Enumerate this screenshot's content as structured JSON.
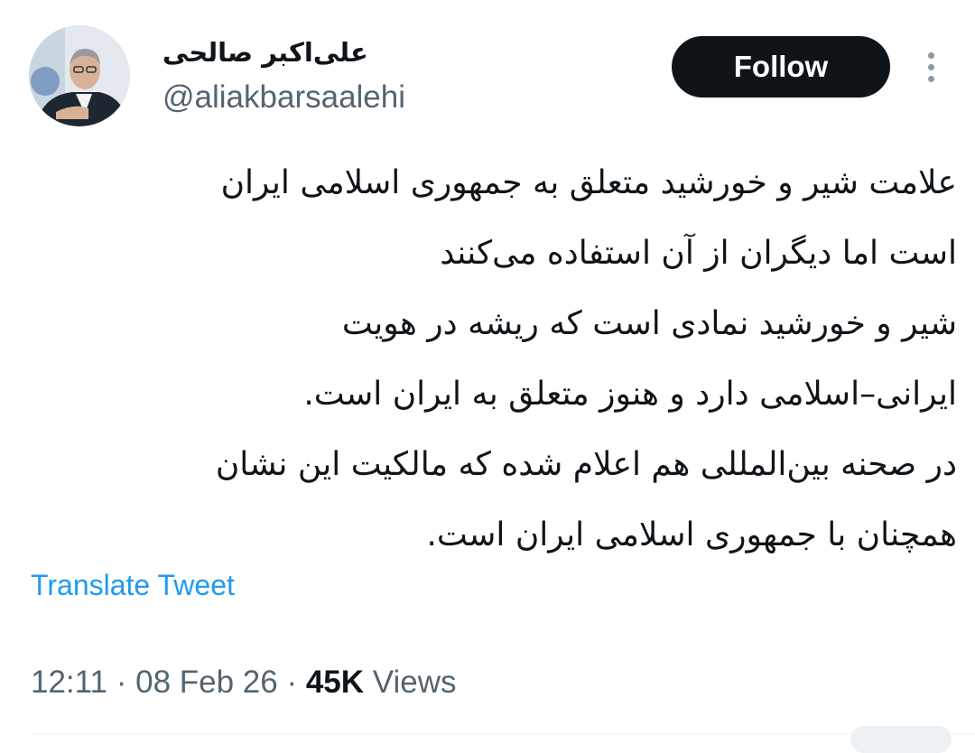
{
  "author": {
    "display_name": "علی‌اکبر صالحی",
    "handle": "@aliakbarsaalehi",
    "avatar_icon": "profile-photo"
  },
  "actions": {
    "follow_label": "Follow",
    "more_icon": "more-vertical-icon"
  },
  "tweet": {
    "lines": [
      "علامت شیر و خورشید متعلق به جمهوری اسلامی ایران",
      "است اما دیگران از آن استفاده می‌کنند",
      "شیر و خورشید نمادی است که ریشه در هویت",
      "ایرانی–اسلامی دارد و هنوز متعلق به ایران است.",
      "در صحنه بین‌المللی هم اعلام شده که مالکیت این نشان",
      "همچنان با جمهوری اسلامی ایران است."
    ],
    "translate_label": "Translate Tweet"
  },
  "meta": {
    "time": "12:11",
    "separator": " · ",
    "date": "08 Feb 26",
    "views_count": "45K",
    "views_label": "Views"
  },
  "colors": {
    "text": "#0f1419",
    "secondary": "#536471",
    "link": "#1d9bf0",
    "button_bg": "#0f1419",
    "button_text": "#ffffff"
  }
}
